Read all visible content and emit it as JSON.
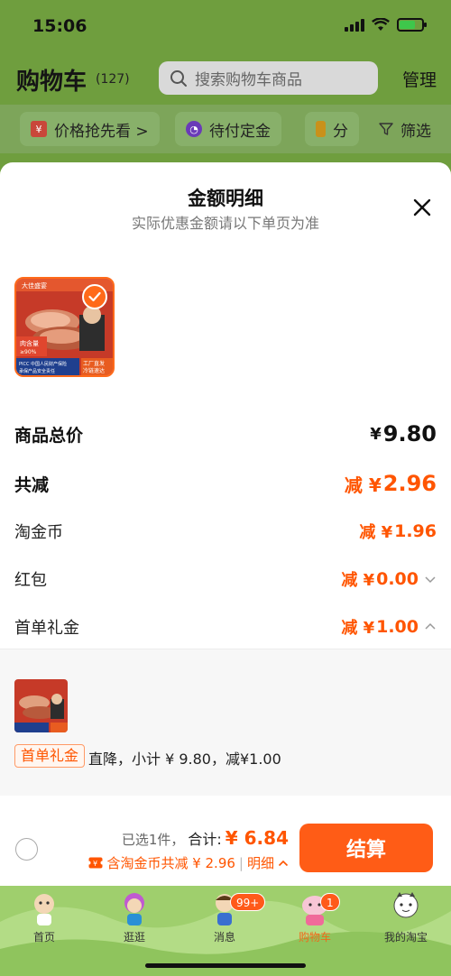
{
  "status_bar": {
    "time": "15:06"
  },
  "cart": {
    "title": "购物车",
    "count": "(127)",
    "search_placeholder": "搜索购物车商品",
    "manage": "管理",
    "filters": [
      {
        "label": "价格抢先看 >",
        "icon": "yen-tag-icon",
        "color": "#e54b3a"
      },
      {
        "label": "待付定金",
        "icon": "clock-icon",
        "color": "#7b3fd6"
      },
      {
        "label": "分",
        "icon": "folder-icon",
        "color": "#e0a21b"
      },
      {
        "label": "筛选",
        "icon": "filter-icon",
        "color": "#333333"
      }
    ]
  },
  "sheet": {
    "title": "金额明细",
    "subtitle": "实际优惠金额请以下单页为准",
    "product_image_badge": {
      "brand": "大佳盛宴",
      "meat_tag": "肉含量",
      "meat_pct": "≥90%",
      "picc": "PICC 中国人民财产保险",
      "picc2": "承保产品安全责任",
      "factory": "工厂直发",
      "cold": "冷链速达"
    },
    "rows": {
      "total_label": "商品总价",
      "total_currency": "¥",
      "total_value": "9.80",
      "reduce_label": "共减",
      "reduce_prefix": "减 ¥",
      "reduce_value": "2.96",
      "coin_label": "淘金币",
      "coin_prefix": "减 ¥",
      "coin_value": "1.96",
      "redpacket_label": "红包",
      "redpacket_prefix": "减 ¥",
      "redpacket_value": "0.00",
      "firstorder_label": "首单礼金",
      "firstorder_prefix": "减 ¥",
      "firstorder_value": "1.00"
    },
    "detail": {
      "tag": "首单礼金",
      "text": "直降，小计 ¥ 9.80，减¥1.00"
    }
  },
  "checkout": {
    "selected": "已选1件，",
    "total_label": "合计:",
    "total_value": "¥ 6.84",
    "discount": "含淘金币共减 ¥ 2.96",
    "sep": "|",
    "detail": "明细",
    "pay": "结算"
  },
  "tabbar": {
    "tabs": [
      {
        "label": "首页"
      },
      {
        "label": "逛逛"
      },
      {
        "label": "消息",
        "badge": "99+"
      },
      {
        "label": "购物车",
        "badge": "1"
      },
      {
        "label": "我的淘宝"
      }
    ]
  },
  "colors": {
    "accent": "#ff5500",
    "button": "#ff5c16",
    "header_green": "#6f9e3e"
  }
}
